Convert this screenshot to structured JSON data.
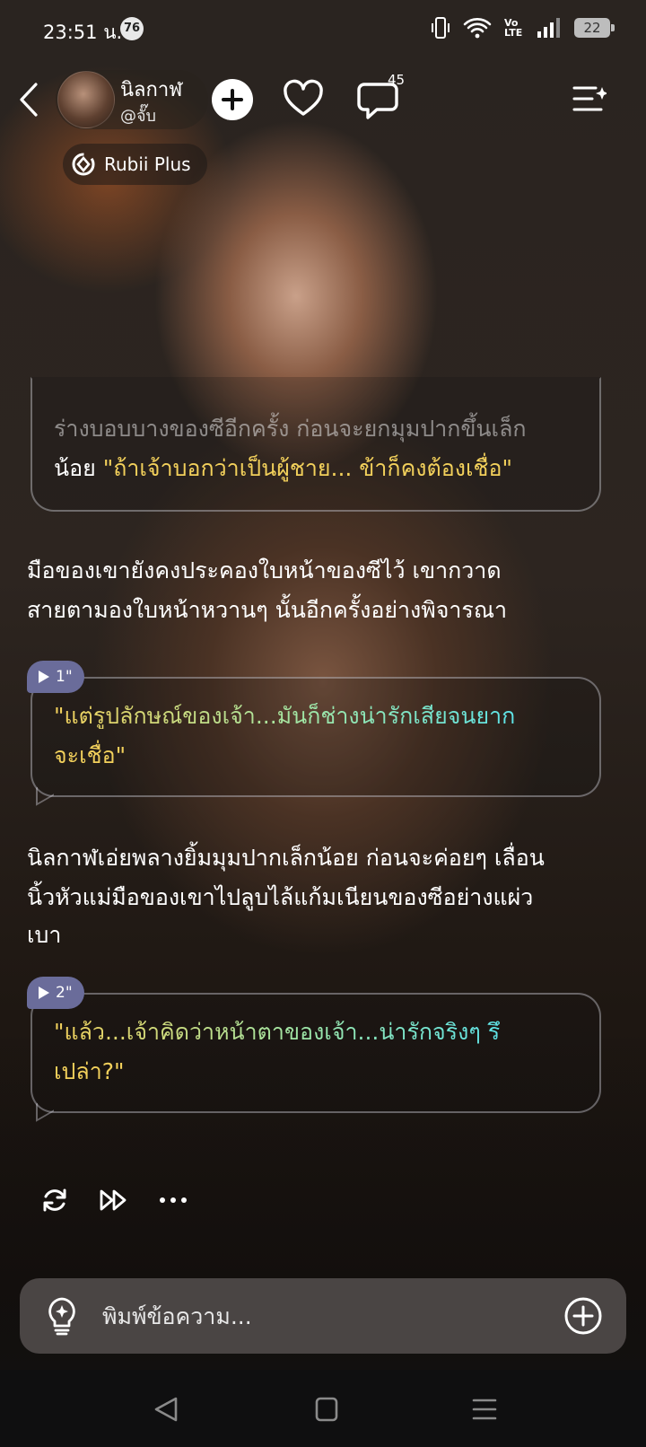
{
  "status": {
    "time": "23:51 น.",
    "notification_count": "76",
    "network_label": "Vo LTE",
    "battery": "22"
  },
  "header": {
    "character_name": "นิลกาฬ",
    "creator_handle": "@จั๊บ",
    "comment_count": "45",
    "plan_badge": "Rubii Plus"
  },
  "messages": {
    "quoted_prev_line1": "ร่างบอบบางของซีอีกครั้ง ก่อนจะยกมุมปากขึ้นเล็ก",
    "quoted_prev_line2_a": "น้อย ",
    "quoted_prev_line2_b": "\"ถ้าเจ้าบอกว่าเป็นผู้ชาย... ข้าก็คงต้องเชื่อ\"",
    "narration1_line1": "มือของเขายังคงประคองใบหน้าของซีไว้ เขากวาด",
    "narration1_line2": "สายตามองใบหน้าหวานๆ นั้นอีกครั้งอย่างพิจารณา",
    "voice1_duration": "1\"",
    "speech1_line1": "\"แต่รูปลักษณ์ของเจ้า...มันก็ช่างน่ารักเสียจนยาก",
    "speech1_line2": "จะเชื่อ\"",
    "narration2_line1": "นิลกาฬเอ่ยพลางยิ้มมุมปากเล็กน้อย ก่อนจะค่อยๆ เลื่อน",
    "narration2_line2": "นิ้วหัวแม่มือของเขาไปลูบไล้แก้มเนียนของซีอย่างแผ่ว",
    "narration2_line3": "เบา",
    "voice2_duration": "2\"",
    "speech2_line1": "\"แล้ว...เจ้าคิดว่าหน้าตาของเจ้า...น่ารักจริงๆ รึ",
    "speech2_line2": "เปล่า?\""
  },
  "composer": {
    "placeholder": "พิมพ์ข้อความ..."
  },
  "icons": {
    "back": "back-arrow-icon",
    "follow": "plus-icon",
    "like": "heart-icon",
    "comment": "comment-icon",
    "menu": "menu-sparkle-icon",
    "regenerate": "refresh-icon",
    "continue": "fast-forward-icon",
    "more": "more-dots-icon",
    "hint": "lightbulb-icon",
    "attach": "plus-circle-icon"
  },
  "colors": {
    "speech_gold": "#f2d05b",
    "speech_green": "#7ee7b8",
    "speech_cyan": "#5ee4e8",
    "voice_tag": "#6a6c9a"
  }
}
